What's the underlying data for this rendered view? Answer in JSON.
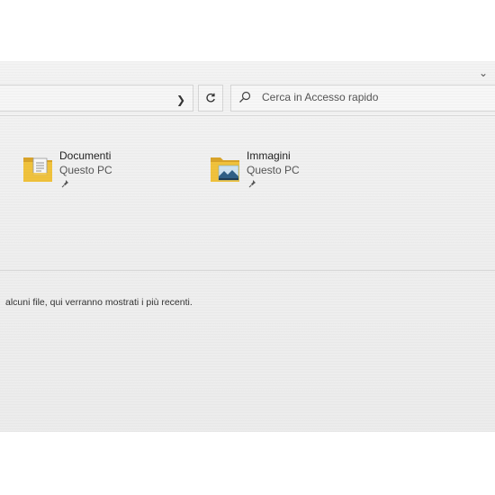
{
  "address": {
    "search_placeholder": "Cerca in Accesso rapido"
  },
  "quick_access": {
    "items": [
      {
        "name": "Documenti",
        "location": "Questo PC",
        "icon": "documents-folder-icon"
      },
      {
        "name": "Immagini",
        "location": "Questo PC",
        "icon": "pictures-folder-icon"
      }
    ]
  },
  "recent": {
    "message": "alcuni file, qui verranno mostrati i più recenti."
  },
  "colors": {
    "folder": "#f0c23c",
    "folder_dark": "#d9a42a",
    "background": "#efefef"
  }
}
